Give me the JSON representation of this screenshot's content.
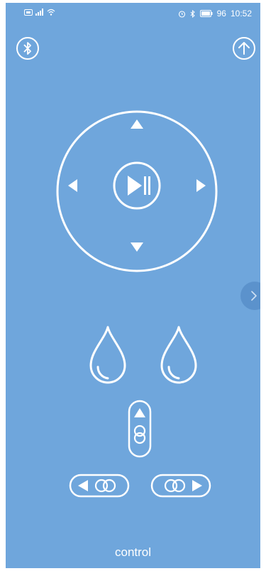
{
  "status_bar": {
    "time": "10:52",
    "battery": "96",
    "icons": [
      "sim-icon",
      "signal-icon",
      "wifi-icon",
      "alarm-icon",
      "bluetooth-icon",
      "battery-icon"
    ]
  },
  "toolbar": {
    "left_icon": "bluetooth-icon",
    "right_icon": "upload-arrow-icon"
  },
  "dpad": {
    "center_icon": "play-pause-icon",
    "directions": [
      "up",
      "down",
      "left",
      "right"
    ]
  },
  "controls": {
    "drops": [
      "water-drop-icon",
      "water-drop-icon"
    ],
    "vertical": "vertical-link-control",
    "horizontal_left": "left-link-control",
    "horizontal_right": "right-link-control"
  },
  "footer": {
    "label": "control"
  },
  "colors": {
    "background": "#6fa6dc",
    "foreground": "#ffffff",
    "side_tab": "#5b92cc"
  }
}
